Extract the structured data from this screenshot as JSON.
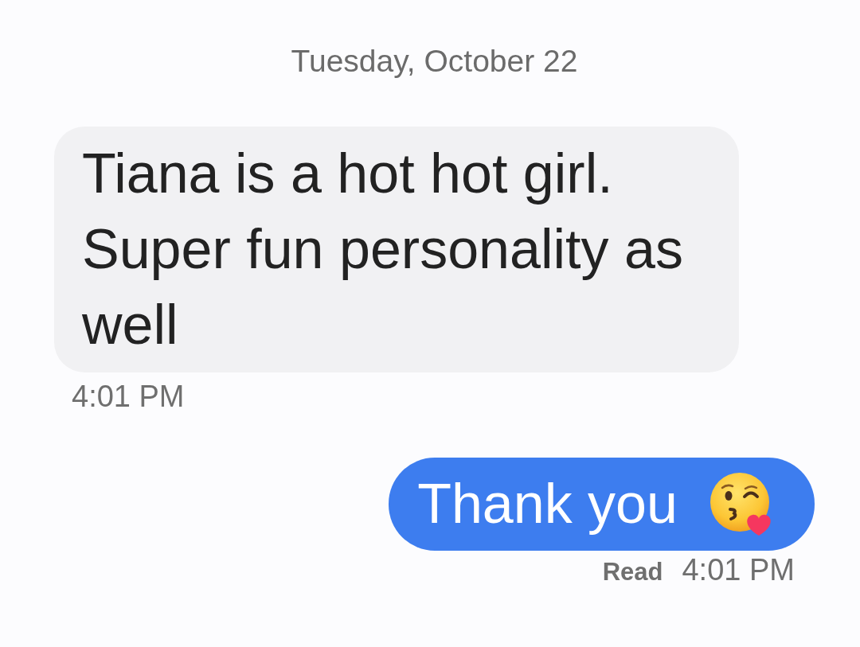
{
  "date_divider": {
    "text": "Tuesday, October 22"
  },
  "messages": [
    {
      "kind": "received",
      "text": "Tiana is a hot hot girl. Super fun personality as well",
      "time": "4:01 PM"
    },
    {
      "kind": "sent",
      "text": "Thank you",
      "emoji": true,
      "status": "Read",
      "time": "4:01 PM"
    }
  ]
}
